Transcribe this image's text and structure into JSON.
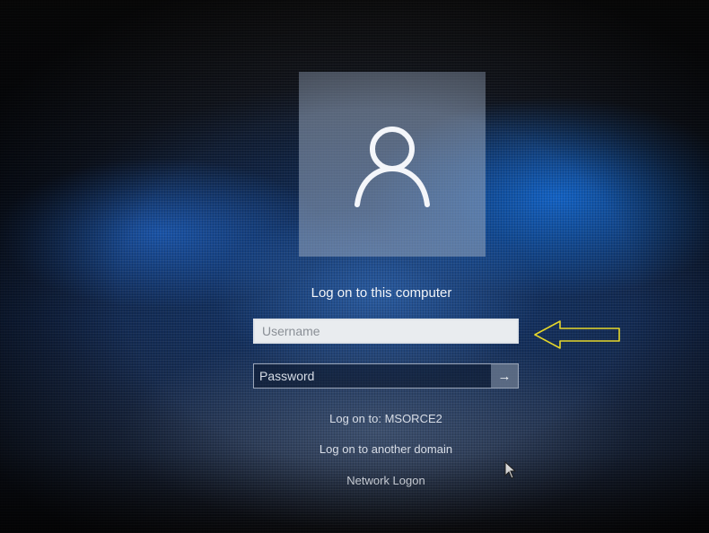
{
  "login": {
    "title": "Log on to this computer",
    "username_placeholder": "Username",
    "password_placeholder": "Password",
    "submit_glyph": "→"
  },
  "links": [
    {
      "label": "Log on to: MSORCE2"
    },
    {
      "label": "Log on to another domain"
    },
    {
      "label": "Network Logon"
    }
  ],
  "colors": {
    "annotation_arrow": "#e5d62a",
    "field_background": "#e9ecef",
    "avatar_tile": "#96a5be"
  },
  "icons": {
    "avatar": "user-silhouette-icon",
    "submit": "arrow-right-icon",
    "annotation": "arrow-left-icon",
    "cursor": "mouse-pointer-icon"
  }
}
